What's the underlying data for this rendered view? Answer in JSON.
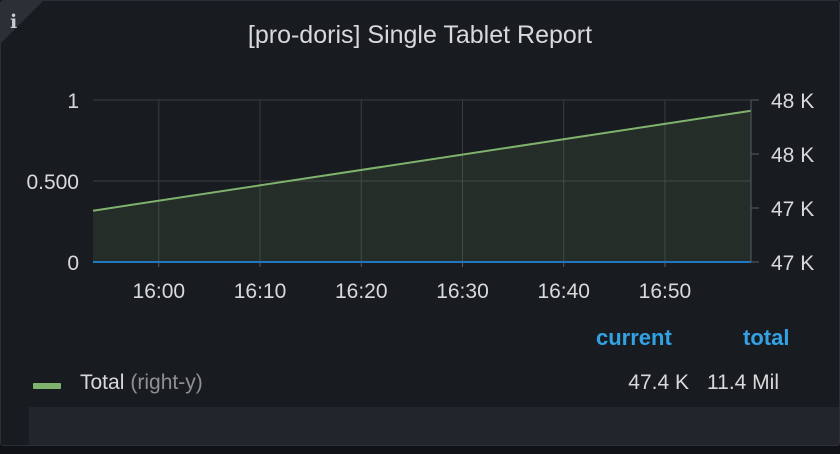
{
  "panel": {
    "title": "[pro-doris] Single Tablet Report",
    "info_icon": "i"
  },
  "chart_data": {
    "type": "area",
    "title": "[pro-doris] Single Tablet Report",
    "x_tick_labels": [
      "16:00",
      "16:10",
      "16:20",
      "16:30",
      "16:40",
      "16:50"
    ],
    "x_range_minutes": [
      -6.5,
      58.5
    ],
    "left_y": {
      "ticks": [
        0,
        0.5,
        1
      ],
      "tick_labels": [
        "0",
        "0.500",
        "1"
      ],
      "ylim": [
        0,
        1
      ]
    },
    "right_y": {
      "tick_labels": [
        "47 K",
        "47 K",
        "48 K",
        "48 K"
      ],
      "ylim": [
        47150,
        47450
      ]
    },
    "grid": true,
    "series": [
      {
        "name": "Total",
        "axis": "right-y",
        "color": "#7eb26d",
        "fill": true,
        "x_minutes": [
          -6.5,
          58.5
        ],
        "y": [
          47245,
          47430
        ]
      },
      {
        "name": "",
        "axis": "left-y",
        "color": "#1f78c1",
        "fill": false,
        "x_minutes": [
          -6.5,
          58.5
        ],
        "y": [
          0,
          0
        ]
      }
    ]
  },
  "legend": {
    "headers": {
      "current": "current",
      "total": "total"
    },
    "rows": [
      {
        "name": "Total",
        "axis_label": "(right-y)",
        "current": "47.4 K",
        "total": "11.4 Mil",
        "color": "#7eb26d"
      }
    ]
  }
}
